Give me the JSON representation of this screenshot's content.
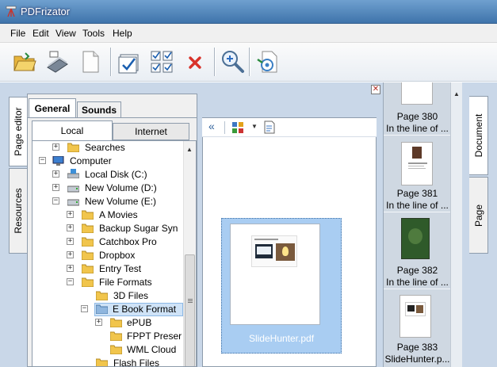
{
  "window": {
    "title": "PDFrizator"
  },
  "menu": [
    "File",
    "Edit",
    "View",
    "Tools",
    "Help"
  ],
  "toolbar": [
    "open-folder-icon",
    "scanner-icon",
    "blank-page-icon",
    "select-page-icon",
    "select-all-icon",
    "delete-icon",
    "zoom-icon",
    "settings-icon"
  ],
  "left_tabs": {
    "page_editor": "Page editor",
    "resources": "Resources"
  },
  "panel_tabs": {
    "general": "General",
    "sounds": "Sounds"
  },
  "sub_tabs": {
    "local": "Local",
    "internet": "Internet"
  },
  "tree": [
    "Searches",
    "Computer",
    "Local Disk (C:)",
    "New Volume (D:)",
    "New Volume (E:)",
    "A Movies",
    "Backup Sugar Syn",
    "Catchbox Pro",
    "Dropbox",
    "Entry Test",
    "File Formats",
    "3D Files",
    "E Book Format",
    "ePUB",
    "FPPT Preser",
    "WML Cloud",
    "Flash Files"
  ],
  "center": {
    "collapse": "«",
    "file_name": "SlideHunter.pdf"
  },
  "pages": [
    {
      "page": "Page 380",
      "caption": "In the line of ..."
    },
    {
      "page": "Page 381",
      "caption": "In the line of ..."
    },
    {
      "page": "Page 382",
      "caption": "In the line of ..."
    },
    {
      "page": "Page 383",
      "caption": "SlideHunter.p..."
    }
  ],
  "right_tabs": {
    "document": "Document",
    "page": "Page"
  },
  "colors": {
    "selection": "#a9cdf2",
    "titlebar": "#4f82b8"
  }
}
